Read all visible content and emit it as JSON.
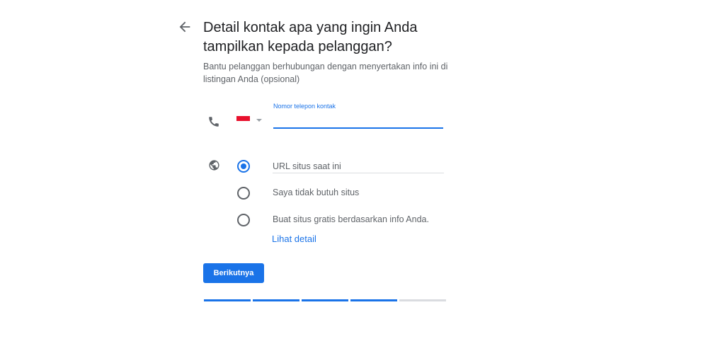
{
  "header": {
    "back_icon": "arrow-left-icon",
    "title": "Detail kontak apa yang ingin Anda tampilkan kepada pelanggan?",
    "subtitle": "Bantu pelanggan berhubungan dengan menyertakan info ini di listingan Anda (opsional)"
  },
  "phone": {
    "icon": "phone-icon",
    "country": "Indonesia flag",
    "label": "Nomor telepon kontak",
    "value": ""
  },
  "website": {
    "icon": "globe-icon",
    "options": [
      {
        "label": "URL situs saat ini",
        "selected": true
      },
      {
        "label": "Saya tidak butuh situs",
        "selected": false
      },
      {
        "label": "Buat situs gratis berdasarkan info Anda.",
        "selected": false
      }
    ],
    "link_label": "Lihat detail"
  },
  "actions": {
    "next_label": "Berikutnya"
  },
  "progress": {
    "completed_steps": 4,
    "total_steps": 5,
    "active_color": "#1a73e8",
    "inactive_color": "#dadce0"
  },
  "colors": {
    "accent": "#1a73e8",
    "text_primary": "#202124",
    "text_secondary": "#5f6368"
  }
}
